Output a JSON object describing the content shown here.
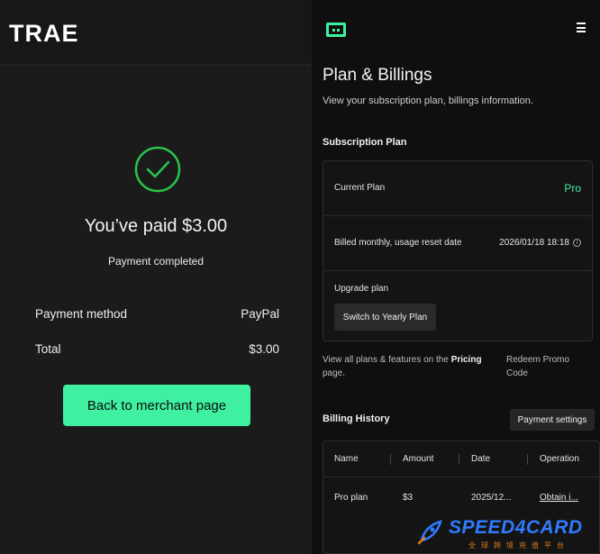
{
  "left": {
    "logo": "TRAE",
    "paid_title": "You’ve paid $3.00",
    "paid_sub": "Payment completed",
    "payment_method_label": "Payment method",
    "payment_method_value": "PayPal",
    "total_label": "Total",
    "total_value": "$3.00",
    "back_button": "Back to merchant page",
    "accent": "#3ff0a0"
  },
  "right": {
    "title": "Plan & Billings",
    "subtitle": "View your subscription plan, billings information.",
    "subscription_title": "Subscription Plan",
    "current_plan_label": "Current Plan",
    "current_plan_value": "Pro",
    "billing_label": "Billed monthly, usage reset date",
    "billing_value": "2026/01/18 18:18",
    "upgrade_label": "Upgrade plan",
    "switch_button": "Switch to Yearly Plan",
    "pricing_note_pre": "View all plans & features on the ",
    "pricing_note_link": "Pricing",
    "pricing_note_post": " page.",
    "redeem": "Redeem Promo Code",
    "billing_history_title": "Billing History",
    "payment_settings_button": "Payment settings",
    "table": {
      "headers": [
        "Name",
        "Amount",
        "Date",
        "Operation"
      ],
      "rows": [
        [
          "Pro plan",
          "$3",
          "2025/12...",
          "Obtain i..."
        ]
      ]
    }
  },
  "watermark": {
    "brand": "SPEED4CARD",
    "tagline": "全球跨境充值平台"
  }
}
